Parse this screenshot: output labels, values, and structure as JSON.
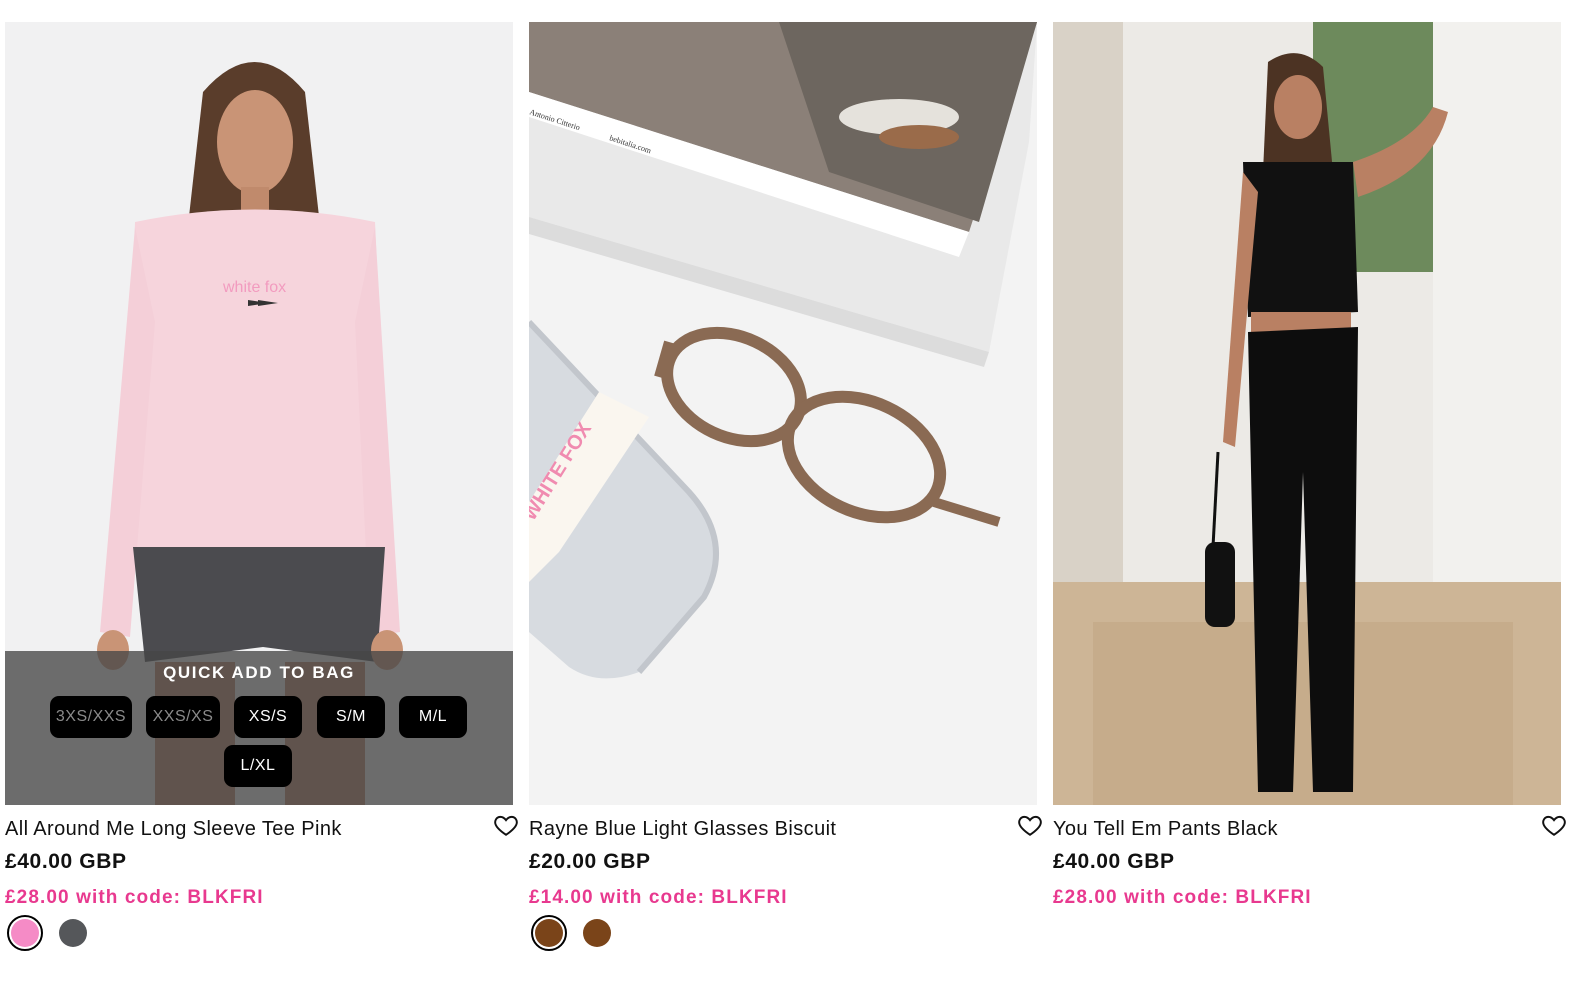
{
  "colors": {
    "promo": "#e8398f",
    "swatch_pink": "#f58bc6",
    "swatch_charcoal": "#55575a",
    "swatch_brown": "#7a4419"
  },
  "products": [
    {
      "name": "All Around Me Long Sleeve Tee Pink",
      "image": "model wearing pink long sleeve tee and charcoal shorts",
      "price": "£40.00 GBP",
      "promo": "£28.00 with code: BLKFRI",
      "quick_add": {
        "title": "QUICK ADD TO BAG",
        "sizes": [
          {
            "label": "3XS/XXS",
            "available": false
          },
          {
            "label": "XXS/XS",
            "available": false
          },
          {
            "label": "XS/S",
            "available": true
          },
          {
            "label": "S/M",
            "available": true
          },
          {
            "label": "M/L",
            "available": true
          },
          {
            "label": "L/XL",
            "available": true
          }
        ]
      },
      "swatches": [
        "pink",
        "charcoal"
      ],
      "selected_swatch": 0
    },
    {
      "name": "Rayne Blue Light Glasses Biscuit",
      "image": "oval brown glasses on magazine with phone and lip tube",
      "price": "£20.00 GBP",
      "promo": "£14.00 with code: BLKFRI",
      "image_text": {
        "mag1": "Antonio Citterio",
        "mag2": "bebitalia.com",
        "tube": "WHITE FOX"
      },
      "swatches": [
        "brown",
        "brown"
      ],
      "selected_swatch": 0
    },
    {
      "name": "You Tell Em Pants Black",
      "image": "model in black halter top and flared pants in hallway",
      "price": "£40.00 GBP",
      "promo": "£28.00 with code: BLKFRI",
      "swatches": [],
      "selected_swatch": -1
    }
  ],
  "icons": {
    "wishlist": "heart-outline-icon"
  }
}
